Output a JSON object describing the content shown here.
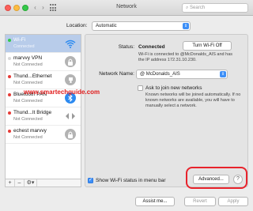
{
  "window": {
    "title": "Network",
    "search_placeholder": "Search"
  },
  "location": {
    "label": "Location:",
    "value": "Automatic"
  },
  "services": [
    {
      "name": "Wi-Fi",
      "status": "Connected",
      "dot_color": "#34c84a",
      "icon": "wifi-icon"
    },
    {
      "name": "marvvy VPN",
      "status": "Not Connected",
      "dot_color": "#d8d8d8",
      "icon": "lock-icon"
    },
    {
      "name": "Thund...Ethernet",
      "status": "Not Connected",
      "dot_color": "#e63b36",
      "icon": "ethernet-icon"
    },
    {
      "name": "Bluetooth PAN",
      "status": "Not Connected",
      "dot_color": "#e63b36",
      "icon": "bluetooth-icon"
    },
    {
      "name": "Thund...It Bridge",
      "status": "Not Connected",
      "dot_color": "#e63b36",
      "icon": "bridge-icon"
    },
    {
      "name": "echest marvvy",
      "status": "Not Connected",
      "dot_color": "#e63b36",
      "icon": "lock-icon"
    }
  ],
  "sidebar_footer": {
    "add": "+",
    "remove": "–",
    "gear": "⚙▾"
  },
  "status": {
    "label": "Status:",
    "value": "Connected",
    "toggle_button": "Turn Wi-Fi Off",
    "description": "Wi-Fi is connected to @McDonalds_AIS and has the IP address 172.31.10.230."
  },
  "network_name": {
    "label": "Network Name:",
    "value": "@ McDonalds_AIS"
  },
  "ask_join": {
    "label": "Ask to join new networks",
    "description": "Known networks will be joined automatically. If no known networks are available, you will have to manually select a network."
  },
  "show_status": {
    "label": "Show Wi-Fi status in menu bar"
  },
  "buttons": {
    "advanced": "Advanced...",
    "help": "?",
    "assist": "Assist me...",
    "revert": "Revert",
    "apply": "Apply"
  },
  "watermark": "www.smartechguide.com",
  "colors": {
    "accent": "#3d8ff7",
    "highlight": "#e8232c",
    "selected_row": "#b8ccea"
  }
}
